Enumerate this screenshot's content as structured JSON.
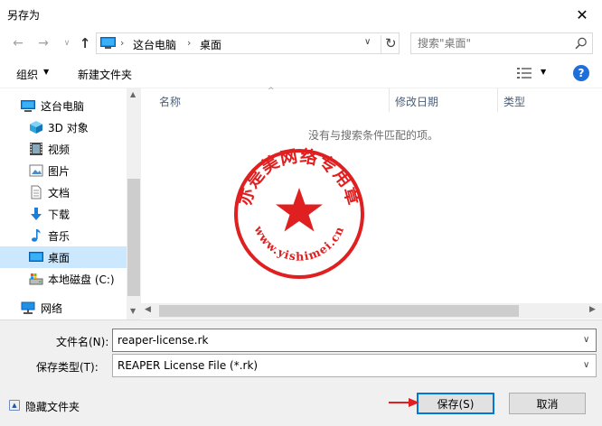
{
  "window": {
    "title": "另存为"
  },
  "nav": {
    "breadcrumbs": [
      "这台电脑",
      "桌面"
    ],
    "search_placeholder": "搜索\"桌面\""
  },
  "toolbar": {
    "organize_label": "组织",
    "new_folder_label": "新建文件夹"
  },
  "sidebar": {
    "items": [
      {
        "label": "这台电脑",
        "icon": "computer-icon"
      },
      {
        "label": "3D 对象",
        "icon": "3d-objects-icon"
      },
      {
        "label": "视频",
        "icon": "video-icon"
      },
      {
        "label": "图片",
        "icon": "pictures-icon"
      },
      {
        "label": "文档",
        "icon": "documents-icon"
      },
      {
        "label": "下载",
        "icon": "downloads-icon"
      },
      {
        "label": "音乐",
        "icon": "music-icon"
      },
      {
        "label": "桌面",
        "icon": "desktop-icon",
        "selected": true
      },
      {
        "label": "本地磁盘 (C:)",
        "icon": "drive-icon"
      },
      {
        "label": "网络",
        "icon": "network-icon"
      }
    ]
  },
  "filelist": {
    "columns": [
      "名称",
      "修改日期",
      "类型"
    ],
    "empty_message": "没有与搜索条件匹配的项。"
  },
  "stamp": {
    "text_top": "亦是美网络专用章",
    "text_bottom": "www.yishimei.cn",
    "color": "#e02020"
  },
  "form": {
    "filename_label": "文件名(N):",
    "filename_value": "reaper-license.rk",
    "filetype_label": "保存类型(T):",
    "filetype_value": "REAPER License File (*.rk)"
  },
  "buttons": {
    "hide_folders_label": "隐藏文件夹",
    "save_label": "保存(S)",
    "cancel_label": "取消"
  },
  "colors": {
    "accent": "#0078d7",
    "selection": "#cce8ff",
    "annotation_arrow": "#e02020"
  }
}
